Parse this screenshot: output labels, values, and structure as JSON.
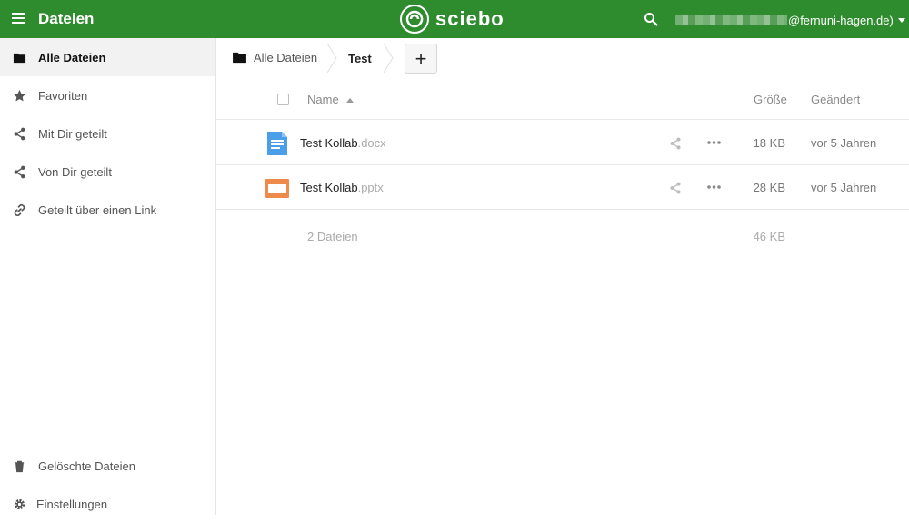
{
  "header": {
    "title": "Dateien",
    "logo_text": "sciebo",
    "user_suffix": "@fernuni-hagen.de)",
    "brand_color": "#2e8b2e"
  },
  "sidebar": {
    "items": [
      {
        "label": "Alle Dateien",
        "icon": "folder-icon",
        "active": true
      },
      {
        "label": "Favoriten",
        "icon": "star-icon"
      },
      {
        "label": "Mit Dir geteilt",
        "icon": "share-icon"
      },
      {
        "label": "Von Dir geteilt",
        "icon": "share-icon"
      },
      {
        "label": "Geteilt über einen Link",
        "icon": "link-icon"
      }
    ],
    "bottom": [
      {
        "label": "Gelöschte Dateien",
        "icon": "trash-icon"
      },
      {
        "label": "Einstellungen",
        "icon": "gear-icon"
      }
    ]
  },
  "breadcrumb": {
    "home": "Alle Dateien",
    "current": "Test",
    "add_label": "+"
  },
  "table": {
    "columns": {
      "name": "Name",
      "size": "Größe",
      "modified": "Geändert"
    },
    "rows": [
      {
        "name": "Test Kollab",
        "ext": ".docx",
        "icon": "docx-file-icon",
        "size": "18 KB",
        "modified": "vor 5 Jahren"
      },
      {
        "name": "Test Kollab",
        "ext": ".pptx",
        "icon": "pptx-file-icon",
        "size": "28 KB",
        "modified": "vor 5 Jahren"
      }
    ],
    "summary": {
      "count": "2 Dateien",
      "size": "46 KB"
    }
  }
}
